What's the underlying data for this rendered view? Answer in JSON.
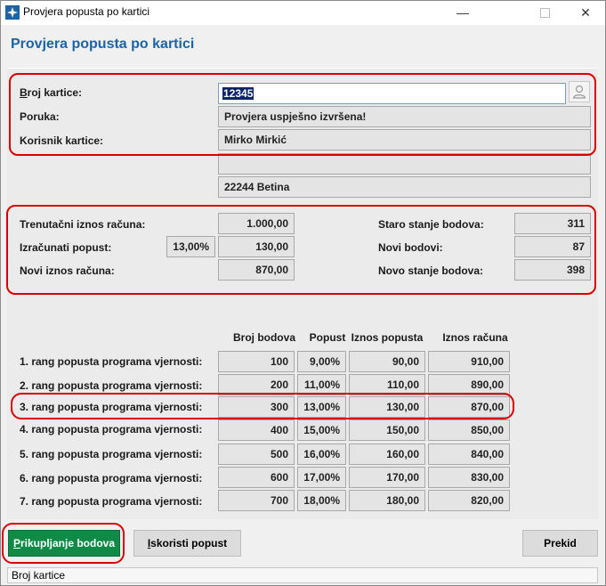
{
  "window": {
    "title": "Provjera popusta po kartici"
  },
  "heading": "Provjera popusta po kartici",
  "card": {
    "broj_label": "Broj kartice:",
    "broj_value": "12345",
    "poruka_label": "Poruka:",
    "poruka_value": "Provjera uspješno izvršena!",
    "korisnik_label": "Korisnik kartice:",
    "korisnik_value": "Mirko Mirkić",
    "address1": "",
    "address2": "22244 Betina"
  },
  "calc": {
    "trenutni_label": "Trenutačni iznos računa:",
    "trenutni_value": "1.000,00",
    "izracunati_label": "Izračunati popust:",
    "izracunati_pct": "13,00%",
    "izracunati_value": "130,00",
    "novi_iznos_label": "Novi iznos računa:",
    "novi_iznos_value": "870,00",
    "staro_label": "Staro stanje bodova:",
    "staro_value": "311",
    "novi_bodovi_label": "Novi bodovi:",
    "novi_bodovi_value": "87",
    "novo_stanje_label": "Novo stanje bodova:",
    "novo_stanje_value": "398"
  },
  "table": {
    "headers": [
      "Broj bodova",
      "Popust",
      "Iznos popusta",
      "Iznos računa"
    ],
    "rows": [
      {
        "label": "1. rang popusta programa vjernosti:",
        "bodovi": "100",
        "popust": "9,00%",
        "iznos_popusta": "90,00",
        "iznos_racuna": "910,00"
      },
      {
        "label": "2. rang popusta programa vjernosti:",
        "bodovi": "200",
        "popust": "11,00%",
        "iznos_popusta": "110,00",
        "iznos_racuna": "890,00"
      },
      {
        "label": "3. rang popusta programa vjernosti:",
        "bodovi": "300",
        "popust": "13,00%",
        "iznos_popusta": "130,00",
        "iznos_racuna": "870,00"
      },
      {
        "label": "4. rang popusta programa vjernosti:",
        "bodovi": "400",
        "popust": "15,00%",
        "iznos_popusta": "150,00",
        "iznos_racuna": "850,00"
      },
      {
        "label": "5. rang popusta programa vjernosti:",
        "bodovi": "500",
        "popust": "16,00%",
        "iznos_popusta": "160,00",
        "iznos_racuna": "840,00"
      },
      {
        "label": "6. rang popusta programa vjernosti:",
        "bodovi": "600",
        "popust": "17,00%",
        "iznos_popusta": "170,00",
        "iznos_racuna": "830,00"
      },
      {
        "label": "7. rang popusta programa vjernosti:",
        "bodovi": "700",
        "popust": "18,00%",
        "iznos_popusta": "180,00",
        "iznos_racuna": "820,00"
      }
    ]
  },
  "buttons": {
    "prikupljanje_first": "P",
    "prikupljanje_rest": "rikupljanje bodova",
    "iskoristi_first": "I",
    "iskoristi_rest": "skoristi popust",
    "prekid": "Prekid"
  },
  "status": "Broj kartice",
  "colors": {
    "heading": "#1c64a8",
    "primary_button": "#0f8a47",
    "highlight": "#d80000"
  }
}
